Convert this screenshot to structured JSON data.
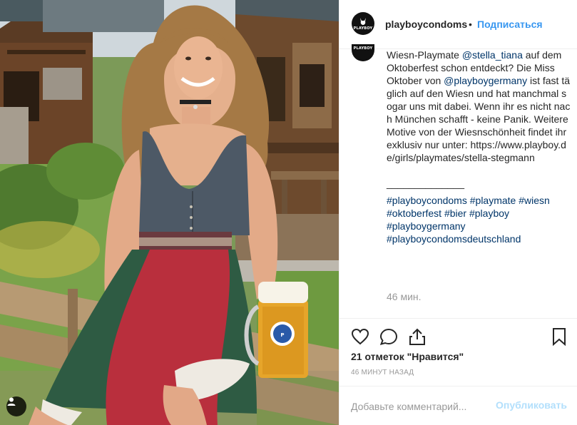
{
  "post": {
    "username": "playboycondoms",
    "separator": "•",
    "follow_label": "Подписаться",
    "avatar_logo_text": "PLAYBOY",
    "caption_lines": {
      "l1_prefix": "Wiesn-Playmate ",
      "l1_mention": "@stella_tiana",
      "l1_suffix": " auf dem Oktoberfest schon entdeckt? Die Miss Oktober von ",
      "l2_mention": "@playboygermany",
      "l2_suffix": " ist fast täglich auf den Wiesn und hat manchmal sogar uns mit dabei. Wenn ihr es nicht nach München schafft - keine Panik. Weitere Motive von der Wiesnschönheit findet ihr exklusiv nur unter: https://www.playboy.de/girls/playmates/stella-stegmann",
      "separator_line": "______________"
    },
    "hashtags": [
      "#playboycondoms",
      "#playmate",
      "#wiesn",
      "#oktoberfest",
      "#bier",
      "#playboy",
      "#playboygermany",
      "#playboycondomsdeutschland"
    ],
    "caption_time": "46 мин.",
    "likes": "21 отметок \"Нравится\"",
    "posted_time": "46 МИНУТ НАЗАД",
    "comment_placeholder": "Добавьте комментарий...",
    "post_button": "Опубликовать"
  },
  "icons": {
    "like": "heart-icon",
    "comment": "comment-icon",
    "share": "share-icon",
    "save": "bookmark-icon",
    "tag": "user-tag-icon"
  },
  "colors": {
    "link": "#003569",
    "follow": "#3897f0",
    "muted": "#999999",
    "post_disabled": "#b2dffc"
  }
}
